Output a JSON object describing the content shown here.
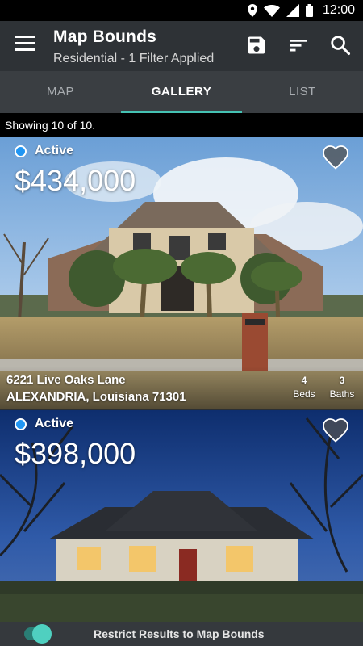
{
  "status_bar": {
    "time": "12:00"
  },
  "app_bar": {
    "title": "Map Bounds",
    "subtitle": "Residential - 1 Filter Applied",
    "icons": [
      "menu-icon",
      "save-icon",
      "sort-icon",
      "search-icon"
    ]
  },
  "tabs": [
    {
      "label": "MAP",
      "active": false
    },
    {
      "label": "GALLERY",
      "active": true
    },
    {
      "label": "LIST",
      "active": false
    }
  ],
  "results_count": "Showing 10 of 10.",
  "listings": [
    {
      "status": "Active",
      "price": "$434,000",
      "address_line1": "6221 Live Oaks Lane",
      "address_line2": "ALEXANDRIA, Louisiana 71301",
      "beds": "4",
      "beds_label": "Beds",
      "baths": "3",
      "baths_label": "Baths",
      "favorite": false
    },
    {
      "status": "Active",
      "price": "$398,000",
      "favorite": false
    }
  ],
  "bottom_bar": {
    "toggle_on": true,
    "label": "Restrict Results to Map Bounds"
  },
  "colors": {
    "accent": "#45c2b3",
    "status_active": "#2196f3"
  }
}
